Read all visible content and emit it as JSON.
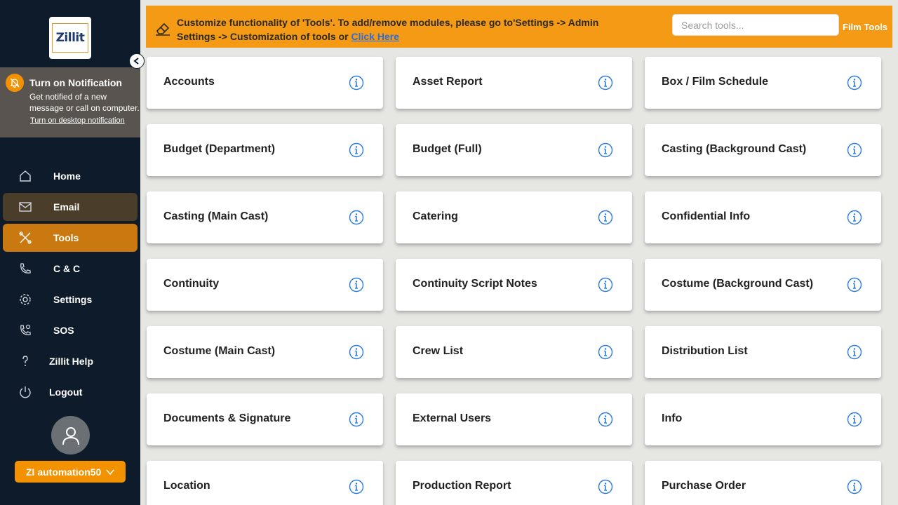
{
  "app": {
    "logo_text": "Zillit"
  },
  "notification": {
    "title": "Turn on Notification",
    "text": "Get notified of a new message or call on computer.",
    "link": "Turn on desktop notification"
  },
  "nav": [
    {
      "label": "Home",
      "icon": "home-icon"
    },
    {
      "label": "Email",
      "icon": "mail-icon"
    },
    {
      "label": "Tools",
      "icon": "tools-icon"
    },
    {
      "label": "C & C",
      "icon": "phone-icon"
    },
    {
      "label": "Settings",
      "icon": "gear-icon"
    },
    {
      "label": "SOS",
      "icon": "sos-phone-icon"
    },
    {
      "label": "Zillit Help",
      "icon": "help-icon"
    },
    {
      "label": "Logout",
      "icon": "power-icon"
    }
  ],
  "user": {
    "name": "ZI automation50"
  },
  "banner": {
    "text": "Customize functionality of 'Tools'. To add/remove modules, please go to'Settings -> Admin Settings -> Customization of tools or",
    "link": "Click Here",
    "search_placeholder": "Search tools...",
    "film_tools": "Film Tools"
  },
  "colors": {
    "accent": "#f39200",
    "sidebar": "#0d1b2a",
    "info": "#2a7ae2"
  },
  "tools": [
    "Accounts",
    "Asset Report",
    "Box / Film Schedule",
    "Budget (Department)",
    "Budget (Full)",
    "Casting (Background Cast)",
    "Casting (Main Cast)",
    "Catering",
    "Confidential Info",
    "Continuity",
    "Continuity Script Notes",
    "Costume (Background Cast)",
    "Costume (Main Cast)",
    "Crew List",
    "Distribution List",
    "Documents & Signature",
    "External Users",
    "Info",
    "Location",
    "Production Report",
    "Purchase Order"
  ]
}
